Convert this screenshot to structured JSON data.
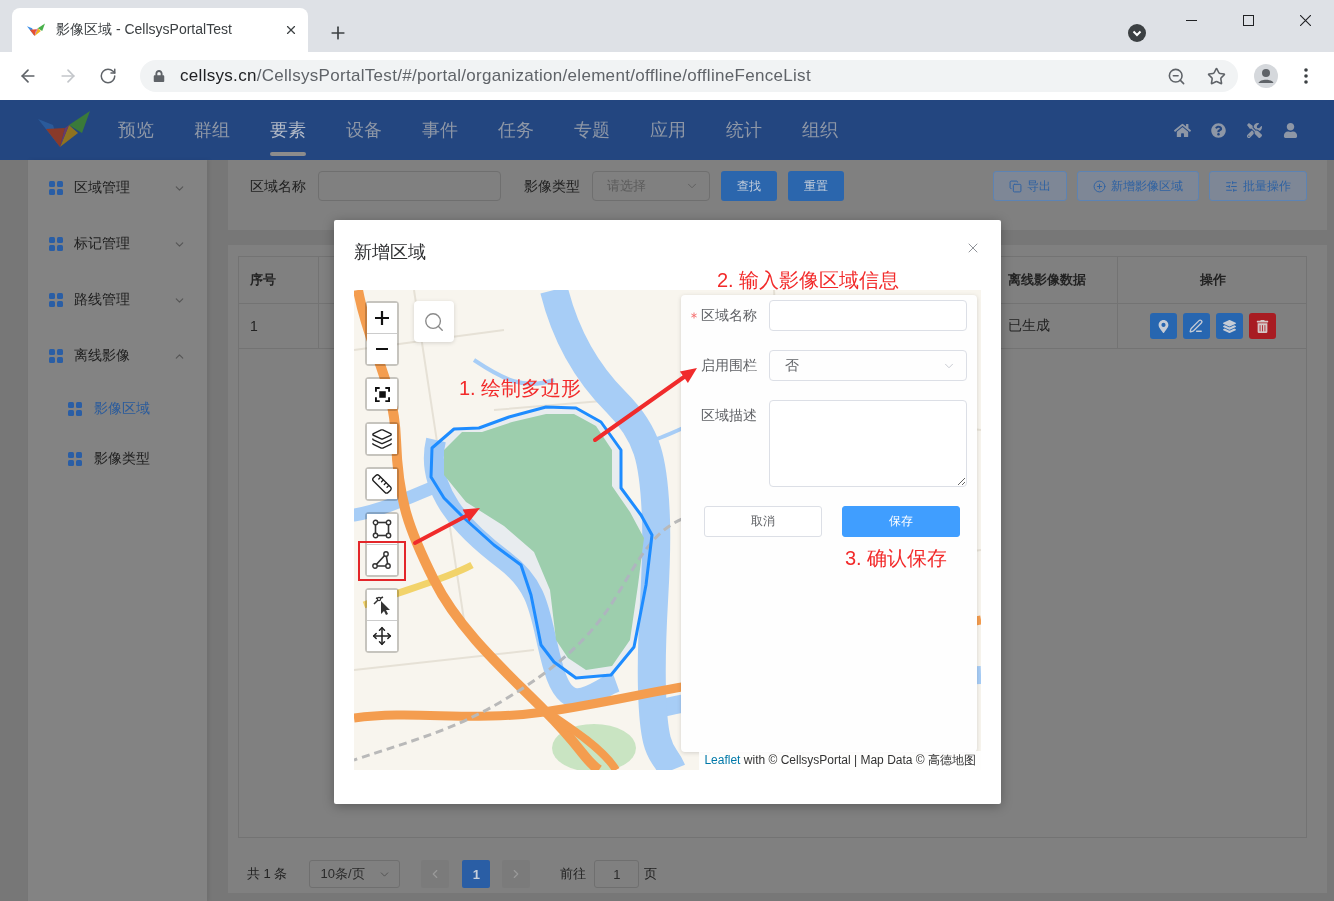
{
  "browser": {
    "tab_title": "影像区域 - CellsysPortalTest",
    "forward_disabled": true,
    "url_host": "cellsys.cn",
    "url_path": "/CellsysPortalTest/#/portal/organization/element/offline/offlineFenceList"
  },
  "nav": {
    "items": [
      {
        "label": "预览",
        "selected": false
      },
      {
        "label": "群组",
        "selected": false
      },
      {
        "label": "要素",
        "selected": true
      },
      {
        "label": "设备",
        "selected": false
      },
      {
        "label": "事件",
        "selected": false
      },
      {
        "label": "任务",
        "selected": false
      },
      {
        "label": "专题",
        "selected": false
      },
      {
        "label": "应用",
        "selected": false
      },
      {
        "label": "统计",
        "selected": false
      },
      {
        "label": "组织",
        "selected": false
      }
    ]
  },
  "sidebar": {
    "items": [
      {
        "label": "区域管理",
        "expanded": false
      },
      {
        "label": "标记管理",
        "expanded": false
      },
      {
        "label": "路线管理",
        "expanded": false
      },
      {
        "label": "离线影像",
        "expanded": true,
        "children": [
          {
            "label": "影像区域",
            "selected": true
          },
          {
            "label": "影像类型",
            "selected": false
          }
        ]
      }
    ]
  },
  "filter": {
    "fields": [
      {
        "kind": "input",
        "label": "区域名称"
      },
      {
        "kind": "select",
        "label": "影像类型",
        "placeholder": "请选择"
      }
    ],
    "buttons": [
      "查找",
      "重置"
    ],
    "actions": [
      "导出",
      "新增影像区域",
      "批量操作"
    ]
  },
  "table": {
    "header": [
      "序号",
      "离线影像数据",
      "操作"
    ],
    "rows": [
      {
        "cells": [
          "1",
          "已生成"
        ],
        "actions": [
          {
            "color": "#2766b0"
          },
          {
            "color": "#2766b0"
          },
          {
            "color": "#2766b0"
          },
          {
            "color": "#a81c22"
          }
        ]
      }
    ]
  },
  "pagination": {
    "total": "共 1 条",
    "page_size": "10条/页",
    "prev_disabled": true,
    "pages": [
      {
        "label": "1",
        "selected": true
      }
    ],
    "next_disabled": true,
    "goto_label": "前往",
    "goto_value": "1",
    "goto_suffix": "页"
  },
  "modal": {
    "title": "新增区域",
    "map": {
      "tools": [
        {
          "highlighted": false
        },
        {
          "highlighted": false
        },
        {
          "highlighted": false
        },
        {
          "highlighted": false
        },
        {
          "highlighted": false
        },
        {
          "highlighted": false
        },
        {
          "highlighted": false
        },
        {
          "highlighted": true
        },
        {
          "highlighted": false
        },
        {
          "highlighted": false
        }
      ],
      "attribution_link": "Leaflet",
      "attribution_text": "with © CellsysPortal | Map Data © 高德地图"
    },
    "form": {
      "fields": [
        {
          "kind": "input",
          "label": "区域名称",
          "required": true
        },
        {
          "kind": "select",
          "label": "启用围栏",
          "required": false,
          "value": "否"
        },
        {
          "kind": "textarea",
          "label": "区域描述",
          "required": false
        }
      ],
      "buttons": [
        {
          "kind": "default",
          "label": "取消"
        },
        {
          "kind": "primary",
          "label": "保存"
        }
      ]
    },
    "annotations": [
      "1. 绘制多边形",
      "2. 输入影像区域信息",
      "3. 确认保存"
    ]
  }
}
